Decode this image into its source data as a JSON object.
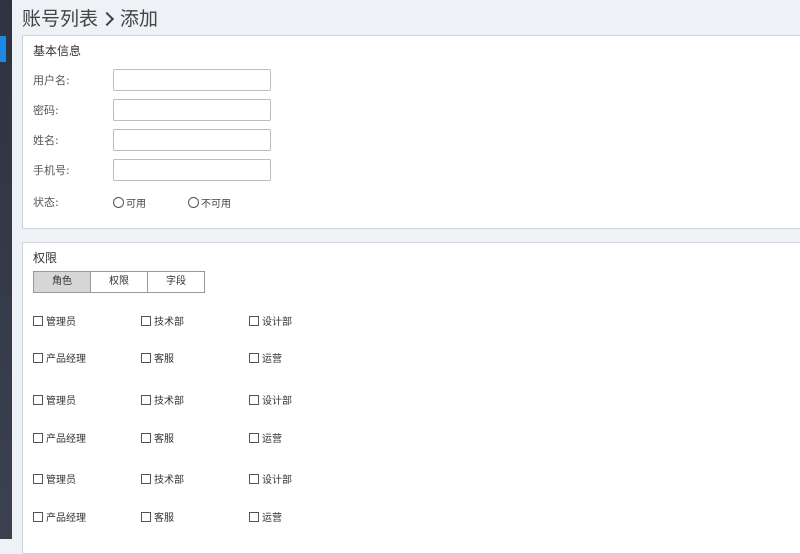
{
  "breadcrumb": {
    "parent": "账号列表",
    "current": "添加"
  },
  "basic": {
    "title": "基本信息",
    "fields": [
      {
        "label": "用户名:",
        "value": "",
        "placeholder": ""
      },
      {
        "label": "密码:",
        "value": "",
        "placeholder": ""
      },
      {
        "label": "姓名:",
        "value": "",
        "placeholder": ""
      },
      {
        "label": "手机号:",
        "value": "",
        "placeholder": ""
      }
    ],
    "status": {
      "label": "状态:",
      "options": [
        "可用",
        "不可用"
      ]
    }
  },
  "permissions": {
    "title": "权限",
    "tabs": [
      "角色",
      "权限",
      "字段"
    ],
    "active_tab": 0,
    "rows": [
      [
        "管理员",
        "技术部",
        "设计部"
      ],
      [
        "产品经理",
        "客服",
        "运营"
      ],
      [
        "管理员",
        "技术部",
        "设计部"
      ],
      [
        "产品经理",
        "客服",
        "运营"
      ],
      [
        "管理员",
        "技术部",
        "设计部"
      ],
      [
        "产品经理",
        "客服",
        "运营"
      ]
    ]
  },
  "colors": {
    "panel_border": "#c9d6e2",
    "active_tab_bg": "#d6d6d6",
    "sidebar_accent": "#1e88e5"
  },
  "icons": {
    "breadcrumb_separator": "chevron-right-icon",
    "radio": "radio-circle-icon",
    "checkbox": "checkbox-square-icon"
  }
}
